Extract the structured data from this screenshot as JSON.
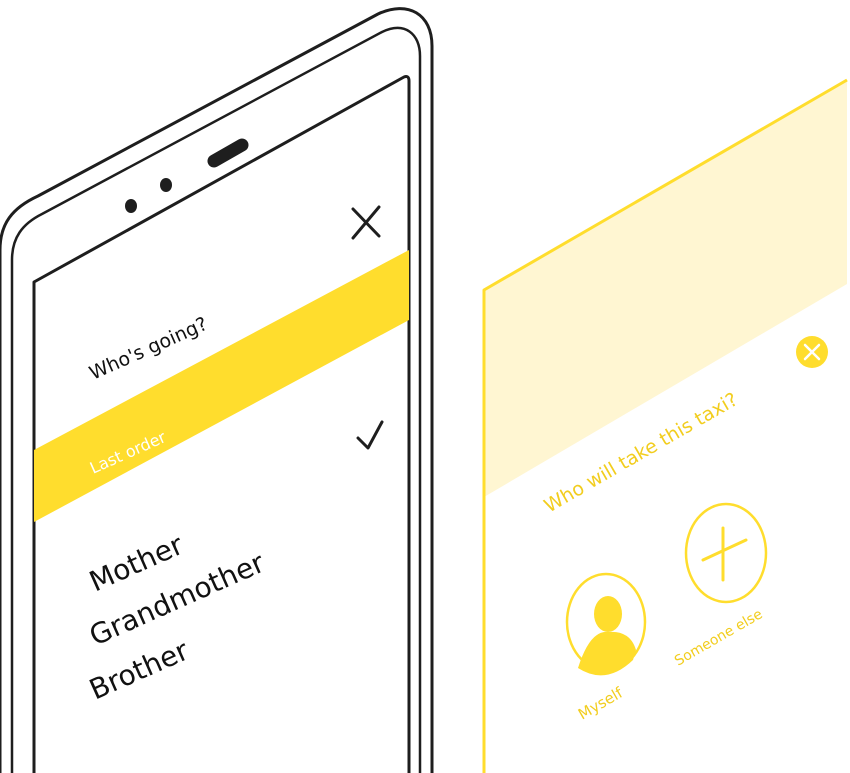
{
  "phone": {
    "title": "Who's going?",
    "highlight_label": "Last order",
    "contacts": [
      "Mother",
      "Grandmother",
      "Brother"
    ],
    "close_icon": "close-icon",
    "check_icon": "checkmark-icon"
  },
  "card": {
    "title": "Who will take this taxi?",
    "close_icon": "close-circle-icon",
    "options": [
      {
        "label": "Myself",
        "icon": "person-icon"
      },
      {
        "label": "Someone else",
        "icon": "plus-icon"
      }
    ]
  },
  "colors": {
    "accent": "#ffdd2d",
    "accent_text": "#f2cd1e",
    "card_header": "#fff6d2",
    "outline": "#1e1e1e"
  }
}
